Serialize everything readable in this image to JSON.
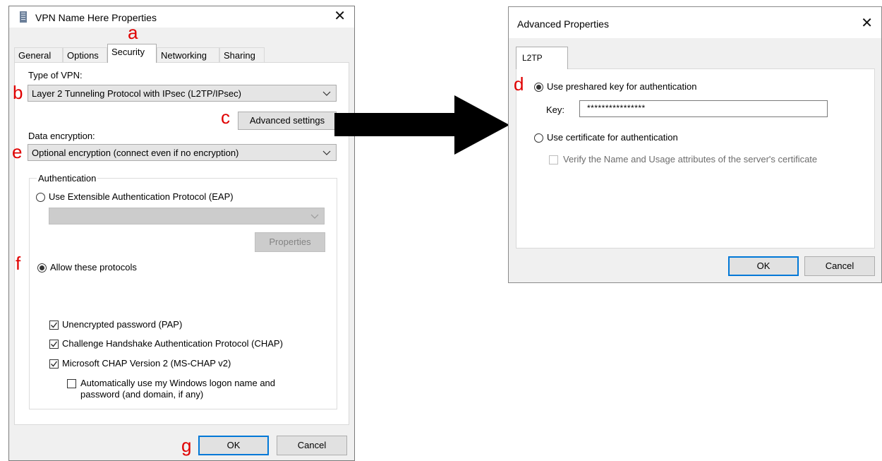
{
  "left_dialog": {
    "title": "VPN Name Here Properties",
    "close_icon": "close-icon",
    "tabs": [
      {
        "label": "General"
      },
      {
        "label": "Options"
      },
      {
        "label": "Security",
        "active": true
      },
      {
        "label": "Networking"
      },
      {
        "label": "Sharing"
      }
    ],
    "type_of_vpn_label": "Type of VPN:",
    "type_of_vpn_value": "Layer 2 Tunneling Protocol with IPsec (L2TP/IPsec)",
    "advanced_settings_label": "Advanced settings",
    "data_encryption_label": "Data encryption:",
    "data_encryption_value": "Optional encryption (connect even if no encryption)",
    "authentication": {
      "group_label": "Authentication",
      "eap_radio_label": "Use Extensible Authentication Protocol (EAP)",
      "eap_select_value": "",
      "properties_label": "Properties",
      "allow_protocols_label": "Allow these protocols",
      "protocols": [
        {
          "label": "Unencrypted password (PAP)",
          "checked": true
        },
        {
          "label": "Challenge Handshake Authentication Protocol (CHAP)",
          "checked": true
        },
        {
          "label": "Microsoft CHAP Version 2 (MS-CHAP v2)",
          "checked": true
        }
      ],
      "auto_logon_line1": "Automatically use my Windows logon name and",
      "auto_logon_line2": "password (and domain, if any)",
      "auto_logon_checked": false
    },
    "ok_label": "OK",
    "cancel_label": "Cancel"
  },
  "right_dialog": {
    "title": "Advanced Properties",
    "tab_label": "L2TP",
    "preshared_radio_label": "Use preshared key for authentication",
    "key_label": "Key:",
    "key_value": "****************",
    "certificate_radio_label": "Use certificate for authentication",
    "verify_label": "Verify the Name and Usage attributes of the server's certificate",
    "ok_label": "OK",
    "cancel_label": "Cancel"
  },
  "annotations": {
    "a": "a",
    "b": "b",
    "c": "c",
    "d": "d",
    "e": "e",
    "f": "f",
    "g": "g"
  },
  "colors": {
    "annotation": "#e00000",
    "default_button_border": "#0078d7",
    "arrow": "#000000"
  }
}
